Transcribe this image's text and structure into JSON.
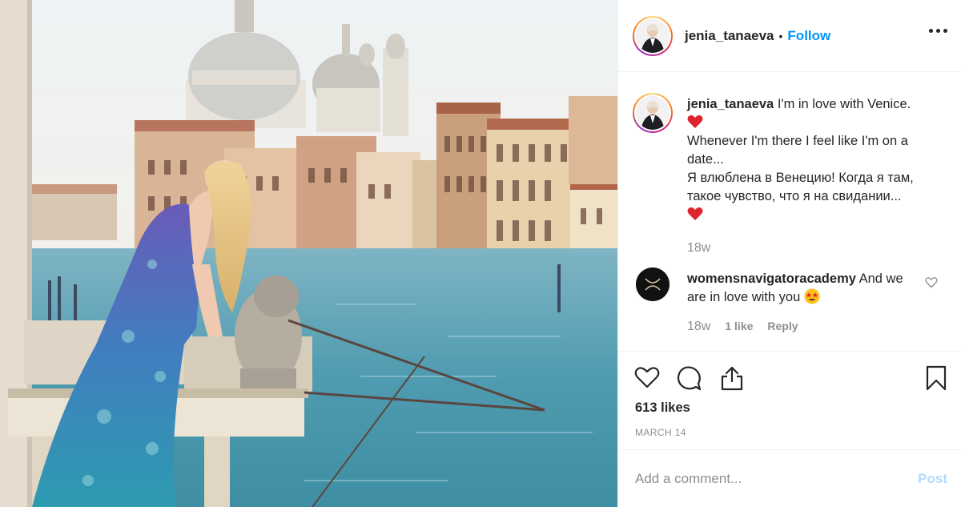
{
  "post": {
    "username": "jenia_tanaeva",
    "follow_label": "Follow",
    "separator": "•"
  },
  "caption": {
    "username": "jenia_tanaeva",
    "line1": "I'm in love with Venice.",
    "line2": "Whenever I'm there I feel like I'm on a date...",
    "line3": "Я влюблена в Венецию! Когда я там, такое чувство, что я на свидании...",
    "time": "18w"
  },
  "comment": {
    "username": "womensnavigatoracademy",
    "text": "And we are in love with you",
    "time": "18w",
    "likes": "1 like",
    "reply": "Reply"
  },
  "actions": {
    "likes": "613 likes",
    "date": "MARCH 14"
  },
  "add_comment": {
    "placeholder": "Add a comment...",
    "post_label": "Post"
  },
  "colors": {
    "link_blue": "#0095f6",
    "post_disabled": "#b3dbff",
    "text": "#262626",
    "muted": "#8e8e8e",
    "heart": "#ed4956"
  },
  "icons": [
    "heart-icon",
    "comment-icon",
    "share-icon",
    "bookmark-icon",
    "more-icon"
  ]
}
